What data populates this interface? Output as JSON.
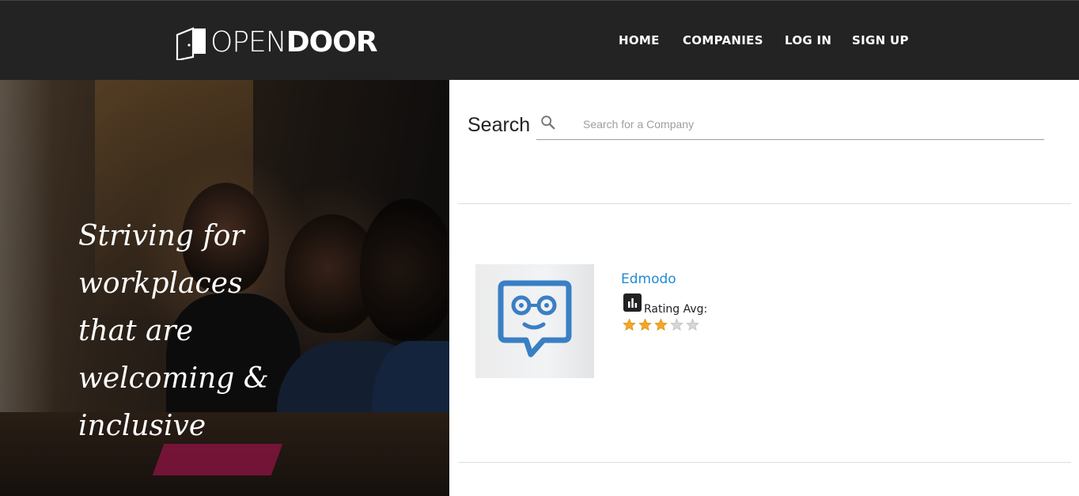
{
  "header": {
    "logo_open": "OPEN",
    "logo_door": "DOOR",
    "nav": {
      "home": "HOME",
      "companies": "COMPANIES",
      "login": "LOG IN",
      "signup": "SIGN UP"
    }
  },
  "hero": {
    "lines": [
      "Striving for",
      "workplaces",
      "that are",
      "welcoming &",
      "inclusive"
    ]
  },
  "search": {
    "label": "Search",
    "placeholder": "Search for a Company",
    "icon": "search-icon"
  },
  "companies": [
    {
      "name": "Edmodo",
      "rating_label": "Rating Avg:",
      "rating_icon": "bar-chart-icon",
      "rating": 3,
      "rating_max": 5
    }
  ],
  "colors": {
    "header_bg": "#232323",
    "link": "#1f8ad6",
    "star_filled": "#f5a623",
    "star_empty": "#d6d6d6",
    "edmodo_blue": "#3a7fc4"
  }
}
